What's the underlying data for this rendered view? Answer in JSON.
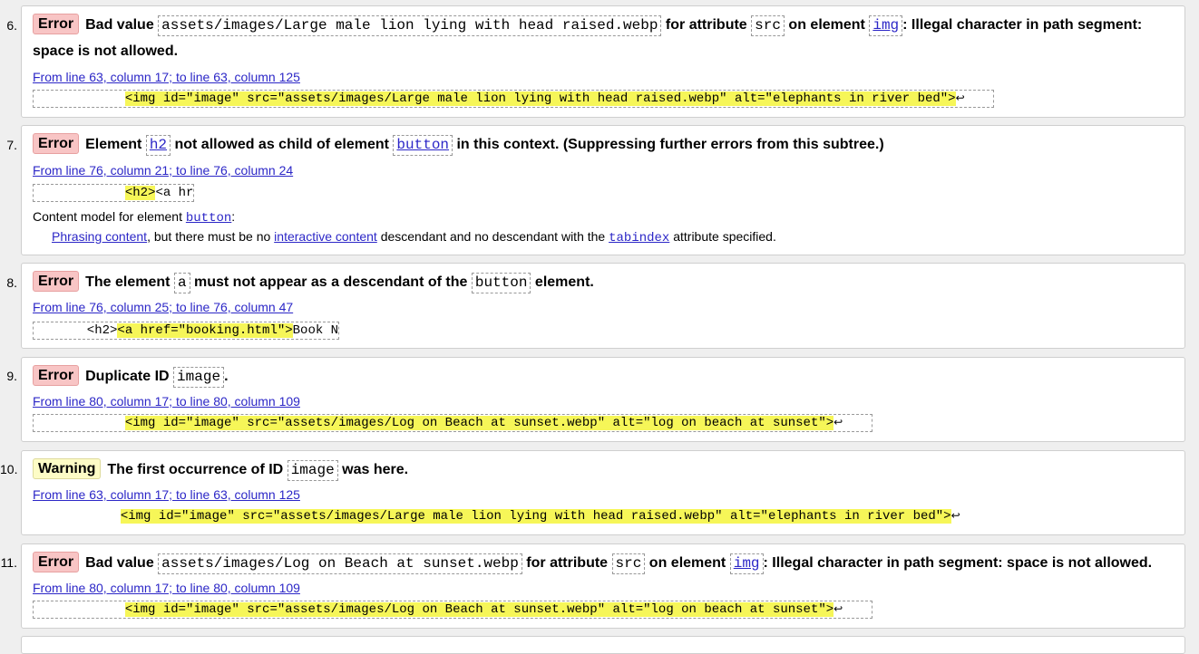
{
  "messages": [
    {
      "number": "6.",
      "type_label": "Error",
      "text_1": "Bad value",
      "code_1": "assets/images/Large male lion lying with head raised.webp",
      "text_2": "for attribute",
      "code_2": "src",
      "text_3": "on element",
      "code_3": "img",
      "text_4": ": Illegal character in path segment:",
      "text_5": "space is not allowed.",
      "location": "From line 63, column 17; to line 63, column 125",
      "extract_pre": "            ",
      "extract_hl": "<img id=\"image\" src=\"assets/images/Large male lion lying with head raised.webp\" alt=\"elephants in river bed\">",
      "extract_post": "↩"
    },
    {
      "number": "7.",
      "type_label": "Error",
      "text_1": "Element",
      "code_1": "h2",
      "text_2": "not allowed as child of element",
      "code_2": "button",
      "text_3": "in this context. (Suppressing further errors from this subtree.)",
      "location": "From line 76, column 21; to line 76, column 24",
      "extract_pre": "            ",
      "extract_hl": "<h2>",
      "extract_post": "<a hre",
      "model_text_1": "Content model for element",
      "model_code": "button",
      "model_text_2": ":",
      "model_link_1": "Phrasing content",
      "model_text_3": ", but there must be no",
      "model_link_2": "interactive content",
      "model_text_4": "descendant and no descendant with the",
      "model_code_2": "tabindex",
      "model_text_5": "attribute specified."
    },
    {
      "number": "8.",
      "type_label": "Error",
      "text_1": "The element",
      "code_1": "a",
      "text_2": "must not appear as a descendant of the",
      "code_2": "button",
      "text_3": "element.",
      "location": "From line 76, column 25; to line 76, column 47",
      "extract_pre": "       <h2>",
      "extract_hl": "<a href=\"booking.html\">",
      "extract_post": "Book N"
    },
    {
      "number": "9.",
      "type_label": "Error",
      "text_1": "Duplicate ID",
      "code_1": "image",
      "text_2": ".",
      "location": "From line 80, column 17; to line 80, column 109",
      "extract_pre": "            ",
      "extract_hl": "<img id=\"image\" src=\"assets/images/Log on Beach at sunset.webp\" alt=\"log on beach at sunset\">",
      "extract_post": "↩"
    },
    {
      "number": "10.",
      "type_label": "Warning",
      "text_1": "The first occurrence of ID",
      "code_1": "image",
      "text_2": "was here.",
      "location": "From line 63, column 17; to line 63, column 125",
      "extract_pre": "            ",
      "extract_hl": "<img id=\"image\" src=\"assets/images/Large male lion lying with head raised.webp\" alt=\"elephants in river bed\">",
      "extract_post": "↩"
    },
    {
      "number": "11.",
      "type_label": "Error",
      "text_1": "Bad value",
      "code_1": "assets/images/Log on Beach at sunset.webp",
      "text_2": "for attribute",
      "code_2": "src",
      "text_3": "on element",
      "code_3": "img",
      "text_4": ": Illegal character in path segment: space is not allowed.",
      "location": "From line 80, column 17; to line 80, column 109",
      "extract_pre": "            ",
      "extract_hl": "<img id=\"image\" src=\"assets/images/Log on Beach at sunset.webp\" alt=\"log on beach at sunset\">",
      "extract_post": "↩"
    }
  ],
  "colors": {
    "error_badge": "#f8c5c5",
    "warning_badge": "#fdfcc6",
    "highlight": "#f6f658",
    "link": "#2c27c7"
  }
}
